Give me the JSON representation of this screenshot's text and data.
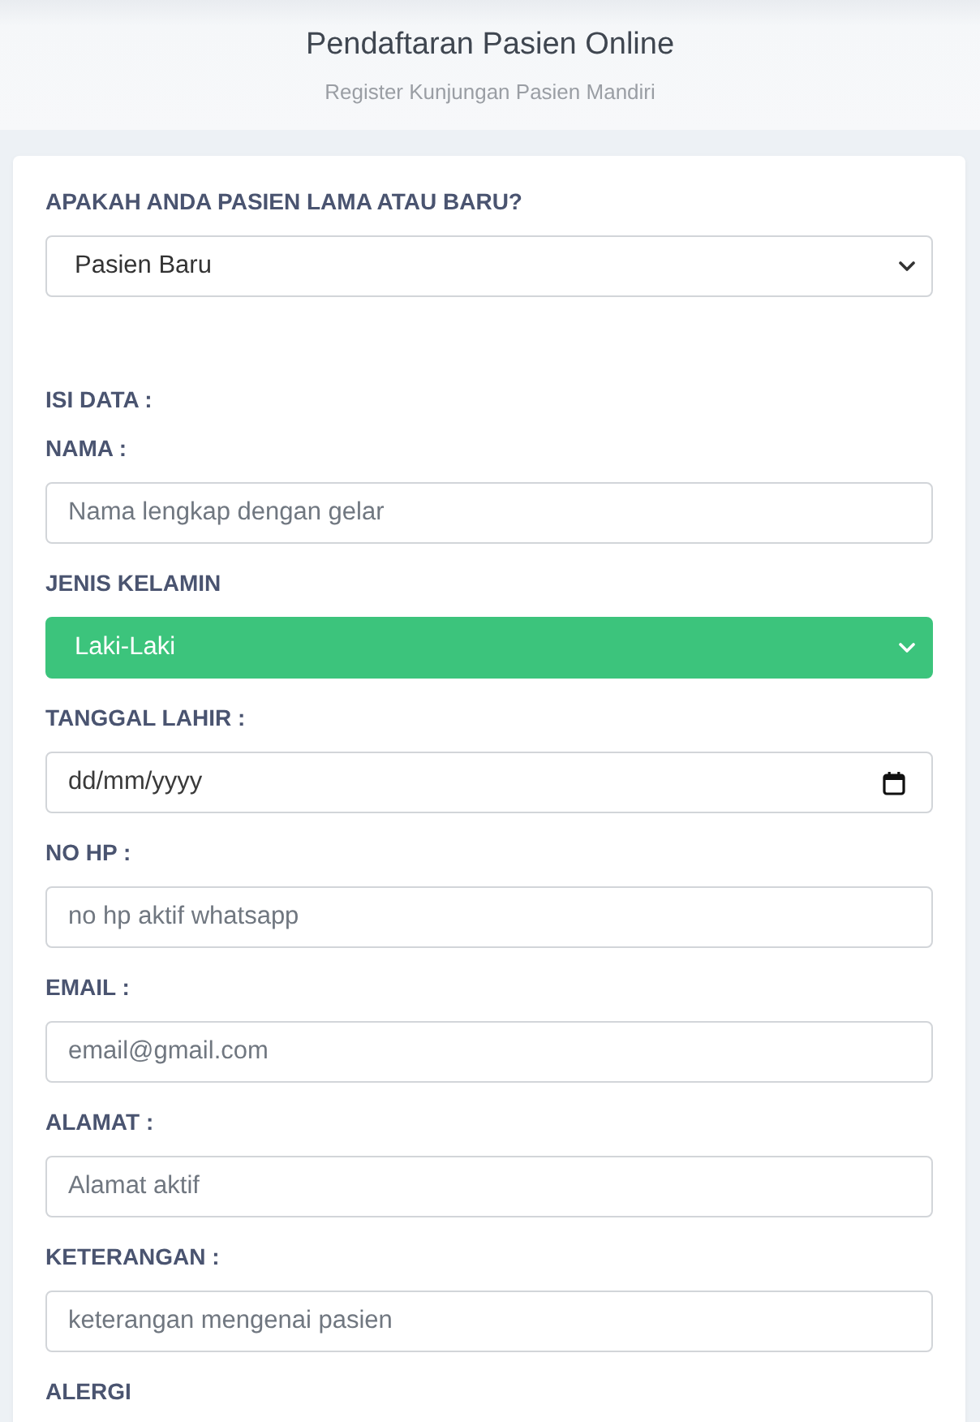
{
  "header": {
    "title": "Pendaftaran Pasien Online",
    "subtitle": "Register Kunjungan Pasien Mandiri"
  },
  "form": {
    "fields": [
      {
        "kind": "select",
        "label": "APAKAH ANDA PASIEN LAMA ATAU BARU?",
        "value": "Pasien Baru",
        "highlighted": false
      },
      {
        "kind": "heading",
        "label": "ISI DATA :"
      },
      {
        "kind": "text",
        "label": "NAMA :",
        "placeholder": "Nama lengkap dengan gelar"
      },
      {
        "kind": "select",
        "label": "JENIS KELAMIN",
        "value": "Laki-Laki",
        "highlighted": true
      },
      {
        "kind": "date",
        "label": "TANGGAL LAHIR :",
        "placeholder": "dd/mm/yyyy"
      },
      {
        "kind": "text",
        "label": "NO HP :",
        "placeholder": "no hp aktif whatsapp"
      },
      {
        "kind": "text",
        "label": "EMAIL :",
        "placeholder": "email@gmail.com"
      },
      {
        "kind": "text",
        "label": "ALAMAT :",
        "placeholder": "Alamat aktif"
      },
      {
        "kind": "text",
        "label": "KETERANGAN :",
        "placeholder": "keterangan mengenai pasien"
      },
      {
        "kind": "label",
        "label": "ALERGI"
      }
    ]
  }
}
